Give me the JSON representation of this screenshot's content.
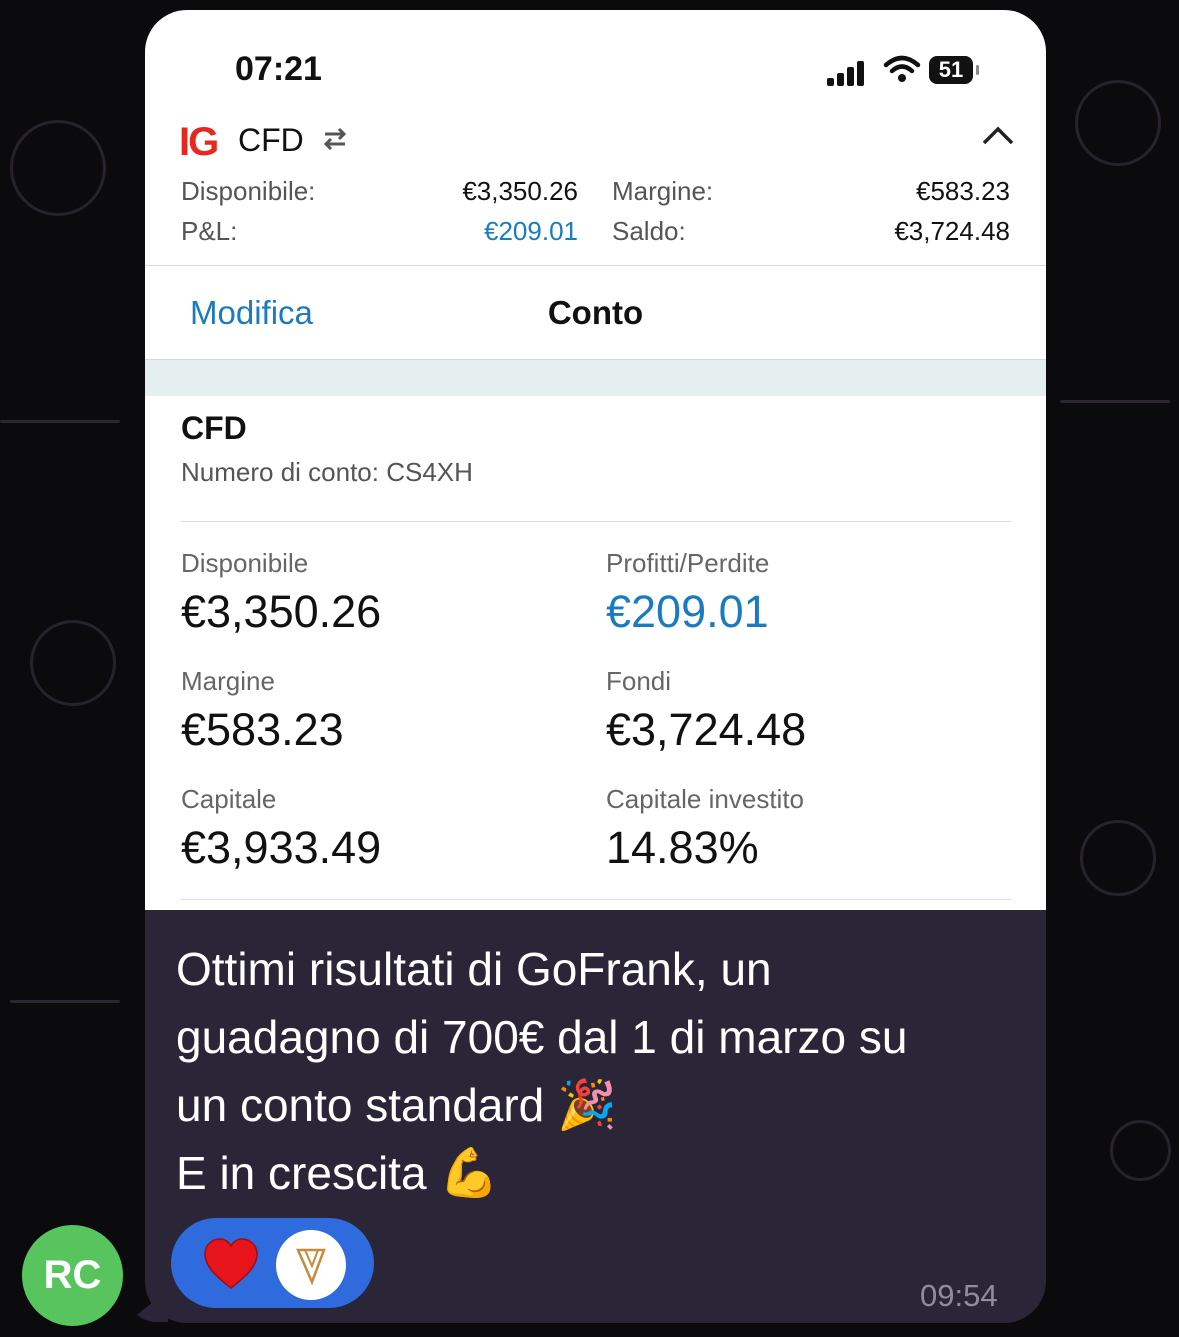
{
  "status_bar": {
    "time": "07:21",
    "battery": "51"
  },
  "account_header": {
    "logo": "IG",
    "account_type": "CFD",
    "summary": {
      "disponibile_label": "Disponibile:",
      "disponibile_value": "€3,350.26",
      "margine_label": "Margine:",
      "margine_value": "€583.23",
      "pl_label": "P&L:",
      "pl_value": "€209.01",
      "saldo_label": "Saldo:",
      "saldo_value": "€3,724.48"
    }
  },
  "nav": {
    "edit_label": "Modifica",
    "title": "Conto"
  },
  "account": {
    "title": "CFD",
    "number_label": "Numero di conto: CS4XH",
    "fields": {
      "disponibile_label": "Disponibile",
      "disponibile_value": "€3,350.26",
      "profitti_label": "Profitti/Perdite",
      "profitti_value": "€209.01",
      "margine_label": "Margine",
      "margine_value": "€583.23",
      "fondi_label": "Fondi",
      "fondi_value": "€3,724.48",
      "capitale_label": "Capitale",
      "capitale_value": "€3,933.49",
      "investito_label": "Capitale investito",
      "investito_value": "14.83%"
    }
  },
  "message": {
    "line1": "Ottimi risultati di GoFrank, un",
    "line2": "guadagno di 700€ dal 1 di marzo su",
    "line3": "un conto standard",
    "line3_emoji": "🎉",
    "line4": "E in crescita",
    "line4_emoji": "💪",
    "time": "09:54"
  },
  "sender": {
    "initials": "RC"
  },
  "colors": {
    "accent_blue": "#1b7bbf",
    "ig_red": "#e6281e",
    "bubble": "#2a2638",
    "reaction_pill": "#2f6bdc",
    "avatar": "#57c45d"
  },
  "icons": [
    "signal-icon",
    "wifi-icon",
    "battery-icon",
    "swap-icon",
    "chevron-up-icon",
    "heart-icon",
    "reactor-avatar-icon"
  ]
}
